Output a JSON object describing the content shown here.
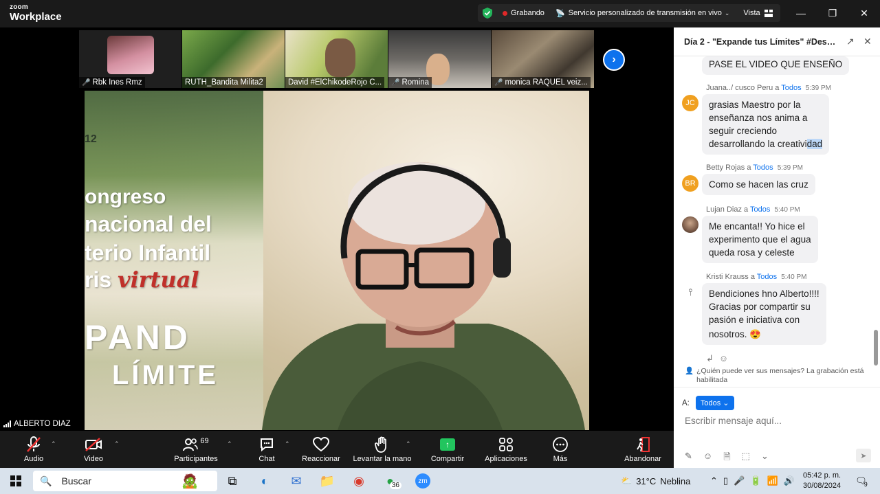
{
  "titlebar": {
    "logo_line1": "zoom",
    "logo_line2": "Workplace",
    "recording": "Grabando",
    "streaming": "Servicio personalizado de transmisión en vivo",
    "view": "Vista"
  },
  "participants": [
    {
      "name": "Rbk Ines Rmz"
    },
    {
      "name": "RUTH_Bandita Milita2"
    },
    {
      "name": "David #ElChikodeRojo C..."
    },
    {
      "name": "Romina"
    },
    {
      "name": "monica RAQUEL veiz..."
    }
  ],
  "main_video": {
    "speaker": "ALBERTO DIAZ",
    "bg_text": {
      "line1": "12",
      "line2": "ongreso",
      "line3": "nacional del",
      "line4": "terio Infantil",
      "line5_a": "ris ",
      "line5_b": "virtual",
      "line6": "PAND",
      "line7": "LÍMITE"
    }
  },
  "toolbar": {
    "audio": "Audio",
    "video": "Video",
    "participants": "Participantes",
    "participants_count": "69",
    "chat": "Chat",
    "react": "Reaccionar",
    "raise_hand": "Levantar la mano",
    "share": "Compartir",
    "apps": "Aplicaciones",
    "more": "Más",
    "leave": "Abandonar"
  },
  "chat": {
    "title": "Día 2 - \"Expande tus Límites\" #Desaf...",
    "messages": [
      {
        "text": "PASE EL VIDEO  QUE ENSEÑO"
      },
      {
        "sender": "Juana../ cusco  Peru",
        "to": "Todos",
        "time": "5:39 PM",
        "initials": "JC",
        "l1": "grasias Maestro por la",
        "l2": "enseñanza   nos anima a",
        "l3": "seguir  creciendo",
        "l4a": "desarrollando la creativi",
        "l4b": "dad"
      },
      {
        "sender": "Betty  Rojas",
        "to": "Todos",
        "time": "5:39 PM",
        "initials": "BR",
        "l1": "Como se hacen las cruz"
      },
      {
        "sender": "Lujan Diaz",
        "to": "Todos",
        "time": "5:40 PM",
        "l1": "Me encanta!! Yo hice el",
        "l2": "experimento que el agua",
        "l3": "queda rosa y celeste"
      },
      {
        "sender": "Kristi Krauss",
        "to": "Todos",
        "time": "5:40 PM",
        "l1": "Bendiciones hno Alberto!!!!",
        "l2": "Gracias por compartir su",
        "l3": "pasión e iniciativa con",
        "l4": "nosotros. 😍"
      }
    ],
    "a_word": "a",
    "notice": "¿Quién puede ver sus mensajes? La grabación está habilitada",
    "to_label": "A:",
    "to_value": "Todos",
    "input_placeholder": "Escribir mensaje aquí..."
  },
  "taskbar": {
    "search": "Buscar",
    "whatsapp_badge": "36",
    "weather_temp": "31°C",
    "weather_desc": "Neblina",
    "time": "05:42 p. m.",
    "date": "30/08/2024",
    "notif_count": "9"
  }
}
